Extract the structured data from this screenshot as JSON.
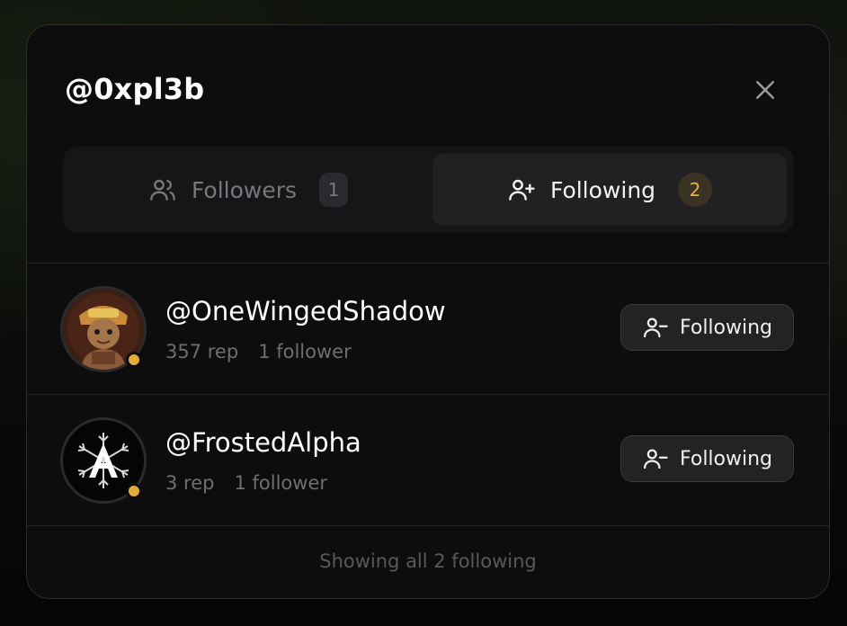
{
  "modal": {
    "title": "@0xpl3b",
    "close_icon": "close-icon"
  },
  "tabs": [
    {
      "label": "Followers",
      "count": "1",
      "icon": "users-icon",
      "active": false
    },
    {
      "label": "Following",
      "count": "2",
      "icon": "user-plus-icon",
      "active": true
    }
  ],
  "users": [
    {
      "handle": "@OneWingedShadow",
      "rep": "357 rep",
      "followers": "1 follower",
      "button_label": "Following",
      "status_color": "#e2ac3d"
    },
    {
      "handle": "@FrostedAlpha",
      "rep": "3 rep",
      "followers": "1 follower",
      "button_label": "Following",
      "status_color": "#e2ac3d"
    }
  ],
  "footer": {
    "text": "Showing all 2 following"
  },
  "colors": {
    "accent": "#e2ac3d",
    "modal_bg": "#0d0d0e",
    "active_tab_bg": "#212124"
  }
}
